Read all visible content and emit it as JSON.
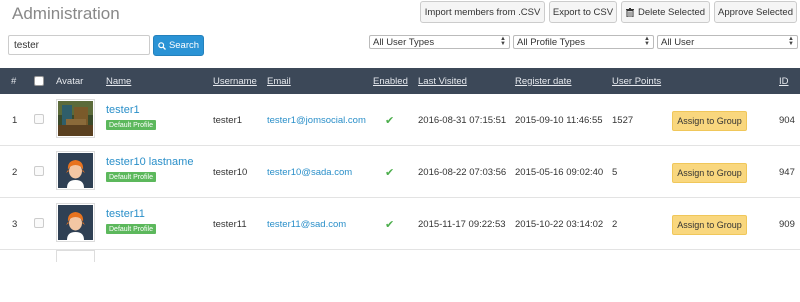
{
  "header": {
    "title": "Administration",
    "import_label": "Import members from .CSV",
    "export_label": "Export to CSV",
    "delete_label": "Delete Selected",
    "approve_label": "Approve Selected"
  },
  "search": {
    "value": "tester",
    "button_label": "Search"
  },
  "filters": {
    "user_types": "All User Types",
    "profile_types": "All Profile Types",
    "users": "All User"
  },
  "columns": {
    "num": "#",
    "avatar": "Avatar",
    "name": "Name",
    "username": "Username",
    "email": "Email",
    "enabled": "Enabled",
    "last_visited": "Last Visited",
    "register_date": "Register date",
    "user_points": "User Points",
    "id": "ID"
  },
  "rows": [
    {
      "num": "1",
      "name": "tester1",
      "badge": "Default Profile",
      "username": "tester1",
      "email": "tester1@jomsocial.com",
      "last_visited": "2016-08-31 07:15:51",
      "register_date": "2015-09-10 11:46:55",
      "user_points": "1527",
      "assign_label": "Assign to Group",
      "id": "904",
      "avatar": "photo"
    },
    {
      "num": "2",
      "name": "tester10 lastname",
      "badge": "Default Profile",
      "username": "tester10",
      "email": "tester10@sada.com",
      "last_visited": "2016-08-22 07:03:56",
      "register_date": "2015-05-16 09:02:40",
      "user_points": "5",
      "assign_label": "Assign to Group",
      "id": "947",
      "avatar": "default"
    },
    {
      "num": "3",
      "name": "tester11",
      "badge": "Default Profile",
      "username": "tester11",
      "email": "tester11@sad.com",
      "last_visited": "2015-11-17 09:22:53",
      "register_date": "2015-10-22 03:14:02",
      "user_points": "2",
      "assign_label": "Assign to Group",
      "id": "909",
      "avatar": "default"
    }
  ],
  "colors": {
    "header_bg": "#3c4858",
    "link": "#2a8fc9",
    "primary": "#2a93d5",
    "badge": "#5cb85c",
    "assign": "#f9d77e"
  }
}
